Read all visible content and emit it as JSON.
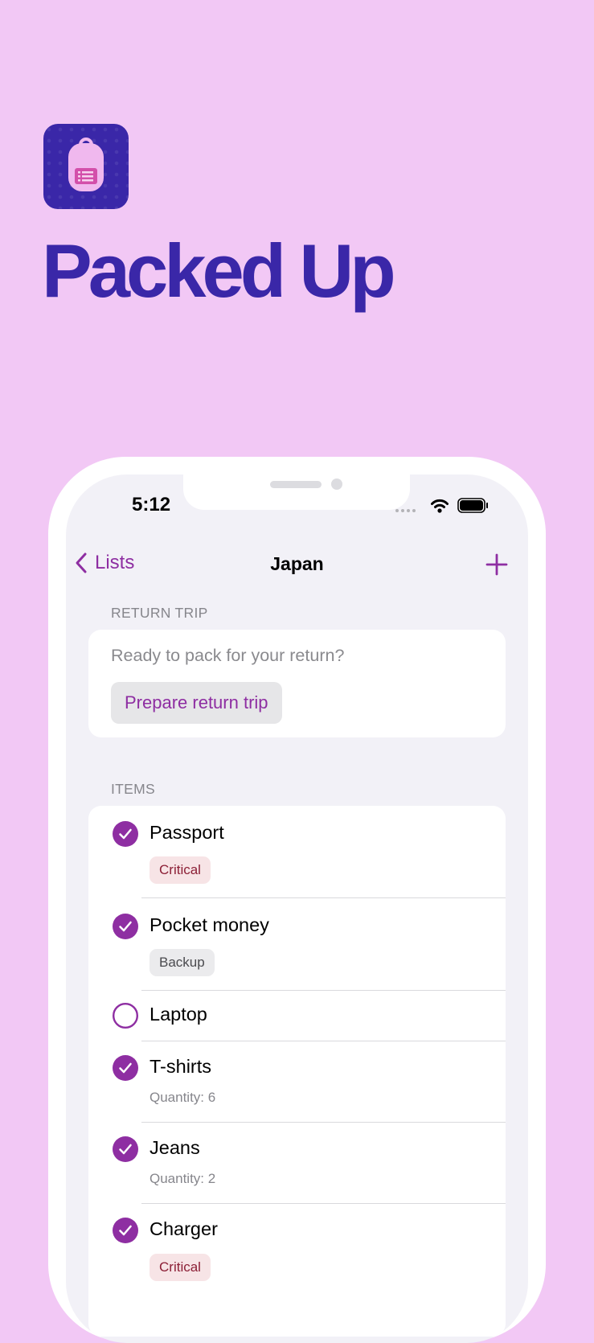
{
  "app": {
    "name": "Packed Up",
    "icon": "backpack-list-icon"
  },
  "colors": {
    "background": "#f2c8f5",
    "brand": "#3a27a8",
    "accent": "#8e2ea2"
  },
  "status_bar": {
    "time": "5:12"
  },
  "nav": {
    "back_label": "Lists",
    "title": "Japan",
    "add_icon": "plus-icon"
  },
  "return_trip": {
    "header": "RETURN TRIP",
    "prompt": "Ready to pack for your return?",
    "button_label": "Prepare return trip"
  },
  "items_section": {
    "header": "ITEMS",
    "items": [
      {
        "name": "Passport",
        "checked": true,
        "tag": "Critical"
      },
      {
        "name": "Pocket money",
        "checked": true,
        "tag": "Backup"
      },
      {
        "name": "Laptop",
        "checked": false
      },
      {
        "name": "T-shirts",
        "checked": true,
        "detail": "Quantity: 6"
      },
      {
        "name": "Jeans",
        "checked": true,
        "detail": "Quantity: 2"
      },
      {
        "name": "Charger",
        "checked": true,
        "tag": "Critical"
      }
    ]
  }
}
